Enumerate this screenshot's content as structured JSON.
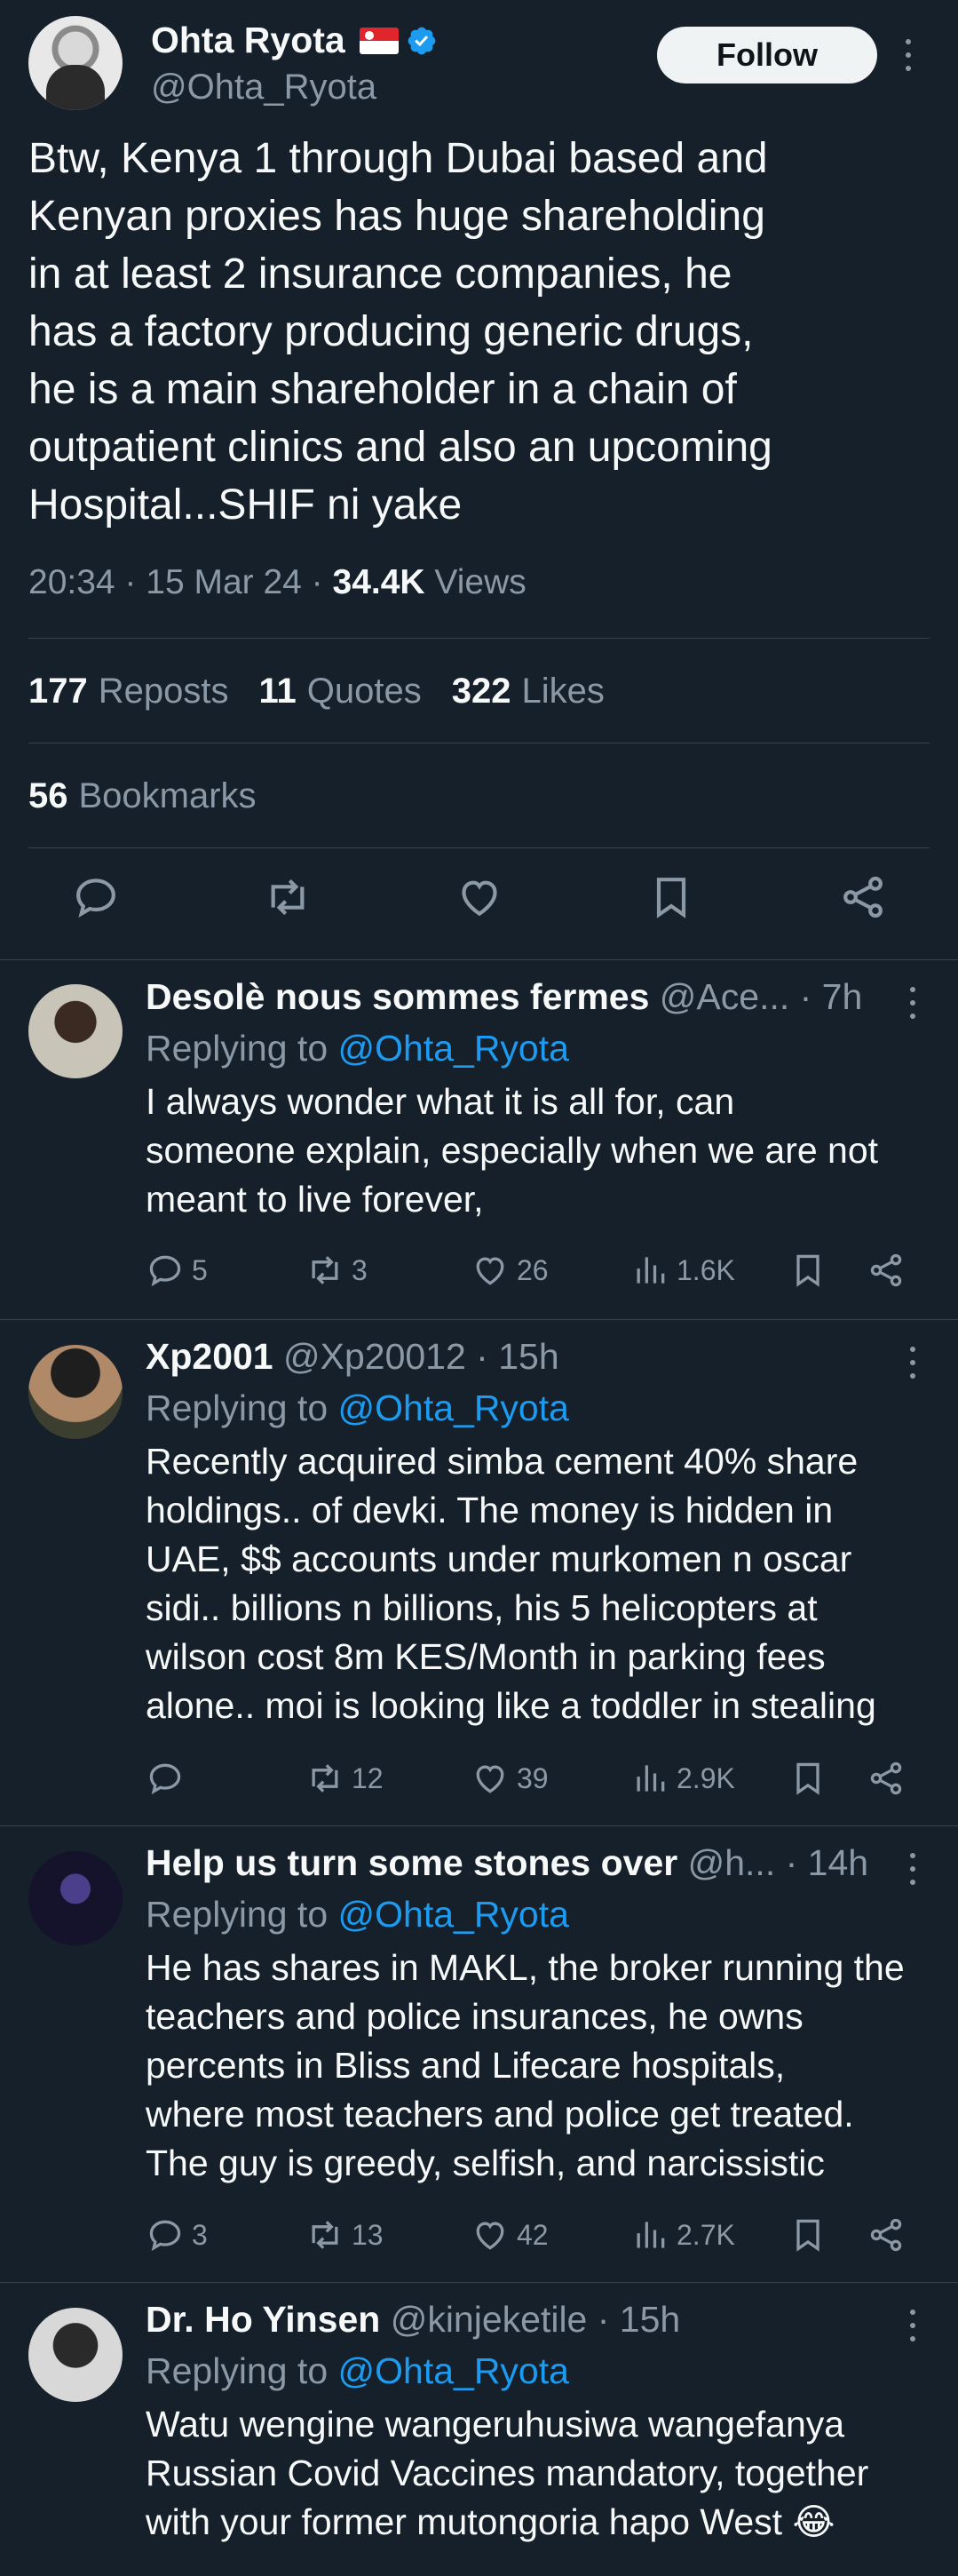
{
  "main_tweet": {
    "author_name": "Ohta Ryota",
    "handle": "@Ohta_Ryota",
    "follow_label": "Follow",
    "text": "Btw, Kenya 1 through Dubai based and\nKenyan proxies has huge shareholding\nin at least 2 insurance companies, he\nhas a factory producing generic drugs,\nhe is a main shareholder in a chain of\noutpatient clinics and also an upcoming\nHospital...SHIF ni yake",
    "time": "20:34 · 15 Mar 24 · ",
    "views_count": "34.4K",
    "views_label": " Views",
    "reposts_count": "177",
    "reposts_label": "Reposts",
    "quotes_count": "11",
    "quotes_label": "Quotes",
    "likes_count": "322",
    "likes_label": "Likes",
    "bookmarks_count": "56",
    "bookmarks_label": "Bookmarks"
  },
  "replies": [
    {
      "name": "Desolè nous sommes fermes",
      "handle": " @Ace...",
      "time": " · 7h",
      "replying_prefix": "Replying to ",
      "replying_to": "@Ohta_Ryota",
      "text": "I always wonder what it is all for, can\nsomeone explain, especially when we are not\nmeant to live forever,",
      "replies": "5",
      "reposts": "3",
      "likes": "26",
      "views": "1.6K"
    },
    {
      "name": "Xp2001",
      "handle": " @Xp20012",
      "time": " · 15h",
      "replying_prefix": "Replying to ",
      "replying_to": "@Ohta_Ryota",
      "text": "Recently acquired simba cement 40% share\nholdings.. of devki. The money is hidden in\nUAE, $$ accounts under murkomen n oscar\nsidi.. billions n billions, his 5 helicopters at\nwilson cost 8m KES/Month in parking fees\nalone.. moi is looking like a toddler in stealing",
      "replies": "",
      "reposts": "12",
      "likes": "39",
      "views": "2.9K"
    },
    {
      "name": "Help us turn some stones over",
      "handle": " @h...",
      "time": " · 14h",
      "replying_prefix": "Replying to ",
      "replying_to": "@Ohta_Ryota",
      "text": "He has shares in MAKL, the broker running the\nteachers and police insurances, he owns\npercents in Bliss and Lifecare hospitals,\nwhere most teachers and police get treated.\nThe guy is greedy, selfish, and narcissistic",
      "replies": "3",
      "reposts": "13",
      "likes": "42",
      "views": "2.7K"
    },
    {
      "name": "Dr. Ho Yinsen",
      "handle": " @kinjeketile",
      "time": " · 15h",
      "replying_prefix": "Replying to ",
      "replying_to": "@Ohta_Ryota",
      "text": "Watu wengine wangeruhusiwa wangefanya\nRussian Covid Vaccines mandatory, together\nwith your former mutongoria hapo West 😂"
    }
  ],
  "colors": {
    "background": "#15202b",
    "text": "#f7f9f9",
    "secondary": "#8b98a5",
    "link": "#1d9bf0",
    "divider": "#38444d"
  }
}
